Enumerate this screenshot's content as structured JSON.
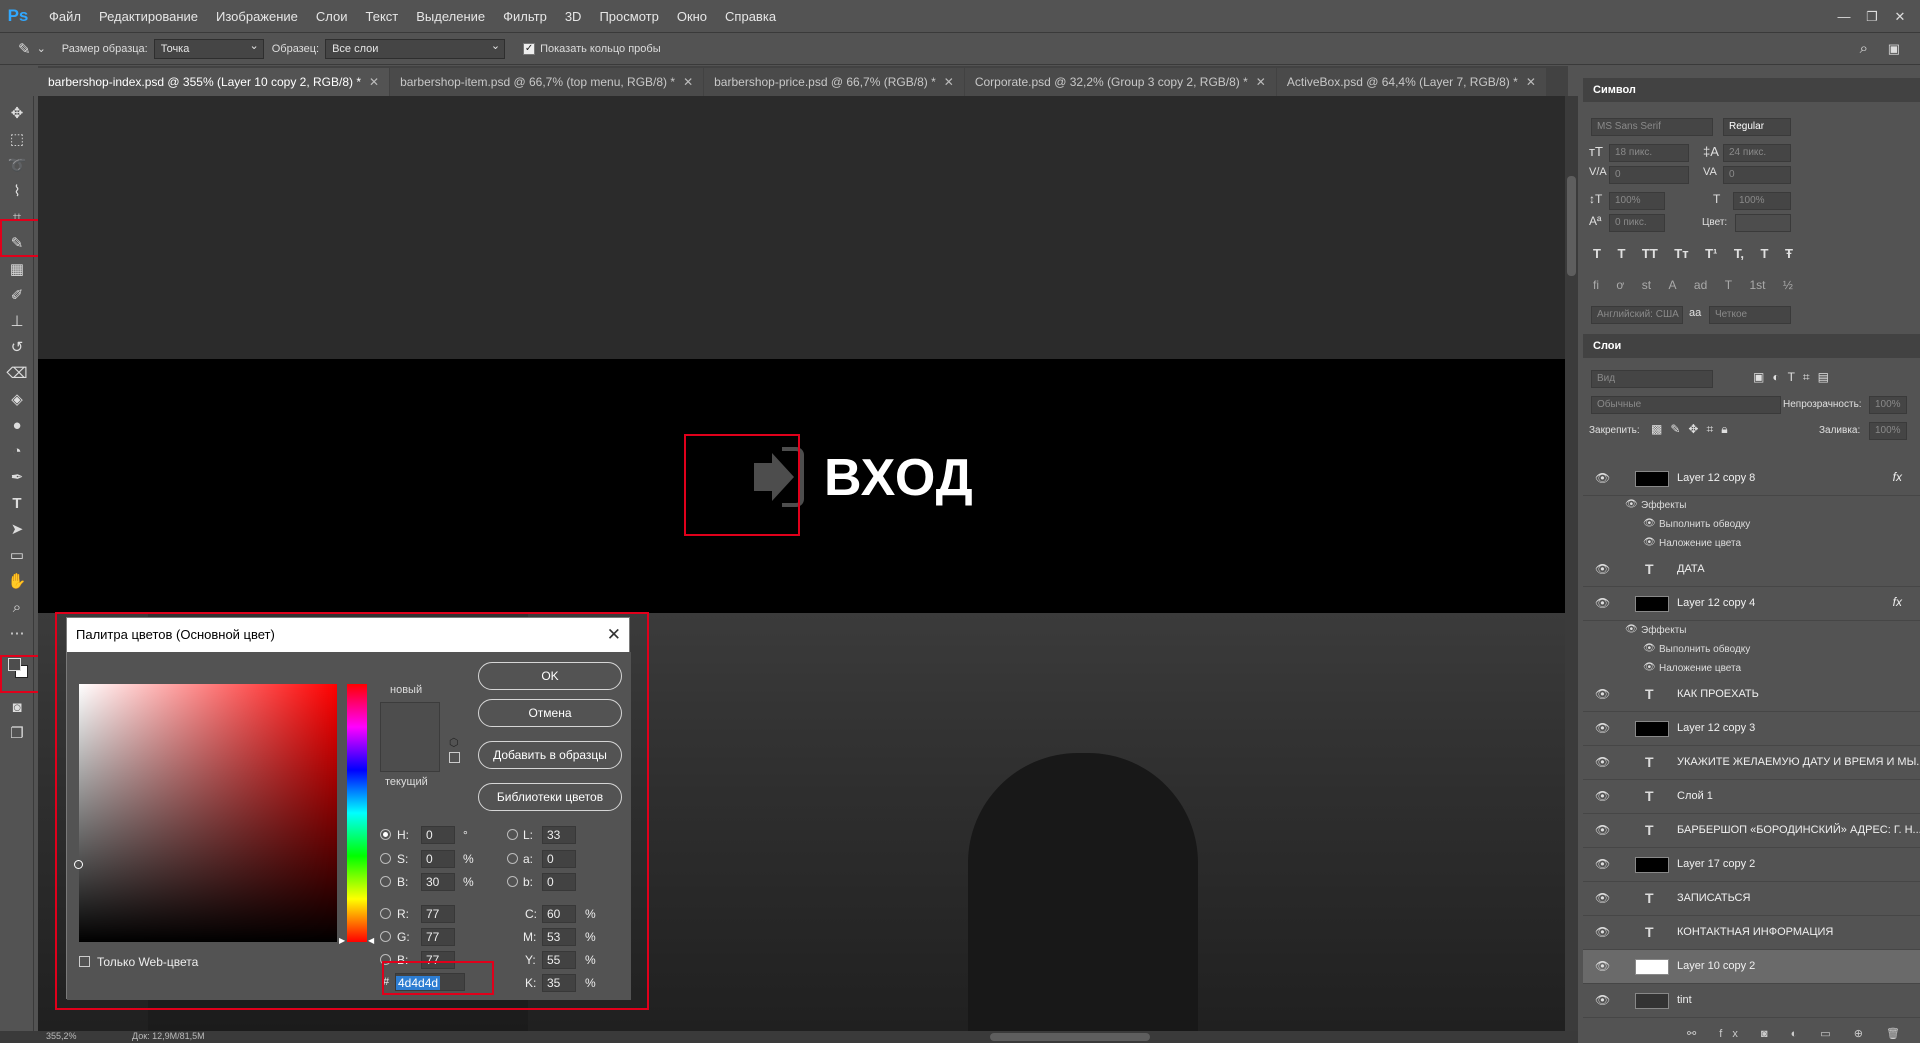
{
  "app": {
    "logo": "Ps"
  },
  "menu": [
    "Файл",
    "Редактирование",
    "Изображение",
    "Слои",
    "Текст",
    "Выделение",
    "Фильтр",
    "3D",
    "Просмотр",
    "Окно",
    "Справка"
  ],
  "window_controls": [
    "—",
    "❐",
    "✕"
  ],
  "options": {
    "sample_size_label": "Размер образца:",
    "sample_size_value": "Точка",
    "sample_label": "Образец:",
    "sample_value": "Все слои",
    "show_ring_label": "Показать кольцо пробы"
  },
  "tabs": [
    {
      "label": "barbershop-index.psd @ 355% (Layer 10 copy 2, RGB/8) *",
      "active": true
    },
    {
      "label": "barbershop-item.psd @ 66,7% (top menu, RGB/8) *",
      "active": false
    },
    {
      "label": "barbershop-price.psd @ 66,7% (RGB/8) *",
      "active": false
    },
    {
      "label": "Corporate.psd @ 32,2% (Group 3 copy 2, RGB/8) *",
      "active": false
    },
    {
      "label": "ActiveBox.psd @ 64,4% (Layer 7, RGB/8) *",
      "active": false
    }
  ],
  "canvas": {
    "login_text": "ВХОД"
  },
  "status": {
    "zoom": "355,2%",
    "doc": "Док: 12,9M/81,5M"
  },
  "character_panel": {
    "title": "Символ",
    "font_family": "MS Sans Serif",
    "font_style": "Regular",
    "size": "18 пикс.",
    "leading": "24 пикс.",
    "kerning": "0",
    "tracking": "0",
    "vscale": "100%",
    "hscale": "100%",
    "baseline": "0 пикс.",
    "color_label": "Цвет:",
    "language": "Английский: США",
    "aa_label": "aa",
    "aa_value": "Четкое",
    "style_glyphs": [
      "T",
      "T",
      "TT",
      "Tт",
      "T¹",
      "T,",
      "T",
      "Ŧ"
    ],
    "ot_glyphs": [
      "fi",
      "ơ",
      "st",
      "A",
      "ad",
      "T",
      "1st",
      "½"
    ]
  },
  "layers_panel": {
    "title": "Слои",
    "search_placeholder": "Вид",
    "blend_mode": "Обычные",
    "opacity_label": "Непрозрачность:",
    "opacity_value": "100%",
    "lock_label": "Закрепить:",
    "fill_label": "Заливка:",
    "fill_value": "100%",
    "effects_label": "Эффекты",
    "stroke_effect": "Выполнить обводку",
    "color_overlay_effect": "Наложение цвета",
    "fx": "fx",
    "layers": [
      {
        "name": "Layer 12 copy 8",
        "kind": "image",
        "fx": true
      },
      {
        "name": "ДАТА",
        "kind": "text"
      },
      {
        "name": "Layer 12 copy 4",
        "kind": "image",
        "fx": true
      },
      {
        "name": "КАК ПРОЕХАТЬ",
        "kind": "text"
      },
      {
        "name": "Layer 12 copy 3",
        "kind": "image"
      },
      {
        "name": "УКАЖИТЕ ЖЕЛАЕМУЮ ДАТУ И ВРЕМЯ И МЫ...",
        "kind": "text"
      },
      {
        "name": "Слой 1",
        "kind": "text"
      },
      {
        "name": "БАРБЕРШОП «БОРОДИНСКИЙ» АДРЕС: Г. Н...",
        "kind": "text"
      },
      {
        "name": "Layer 17 copy 2",
        "kind": "image"
      },
      {
        "name": "ЗАПИСАТЬСЯ",
        "kind": "text"
      },
      {
        "name": "КОНТАКТНАЯ ИНФОРМАЦИЯ",
        "kind": "text"
      },
      {
        "name": "Layer 10 copy 2",
        "kind": "image",
        "selected": true
      },
      {
        "name": "tint",
        "kind": "image"
      }
    ]
  },
  "color_picker": {
    "title": "Палитра цветов (Основной цвет)",
    "new_label": "новый",
    "current_label": "текущий",
    "ok": "OK",
    "cancel": "Отмена",
    "add_swatch": "Добавить в образцы",
    "libraries": "Библиотеки цветов",
    "web_only": "Только Web-цвета",
    "H": "0",
    "S": "0",
    "B": "30",
    "R": "77",
    "G": "77",
    "Bb": "77",
    "L": "33",
    "a": "0",
    "b": "0",
    "C": "60",
    "M": "53",
    "Y": "55",
    "K": "35",
    "hex": "4d4d4d",
    "deg": "°",
    "pct": "%"
  },
  "colors": {
    "current": "#4d4d4d",
    "highlight": "#e0001b",
    "accent": "#31a8ff"
  }
}
